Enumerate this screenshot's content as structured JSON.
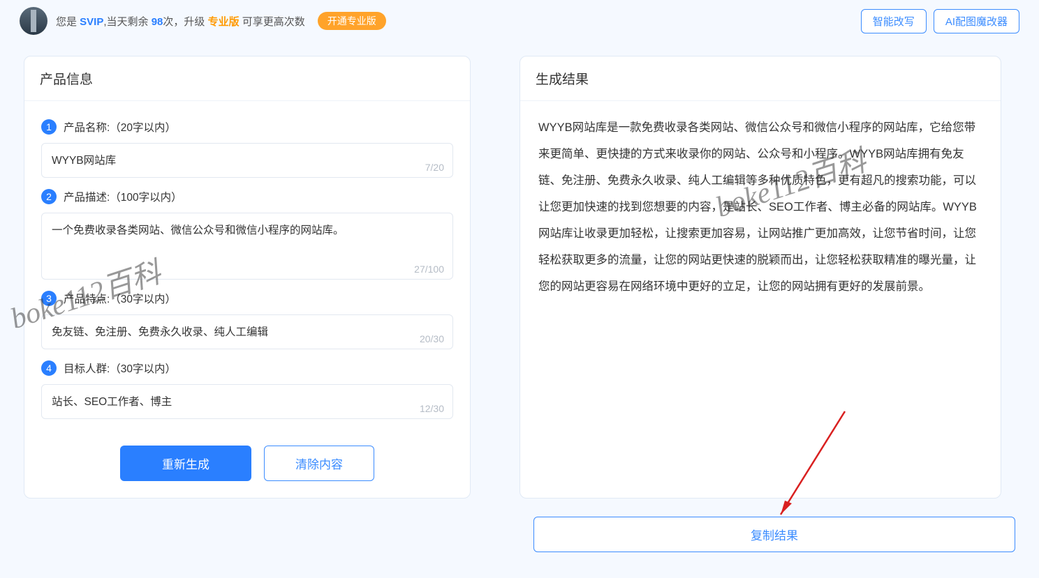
{
  "header": {
    "prefix": "您是 ",
    "svip": "SVIP",
    "mid1": ",当天剩余 ",
    "count": "98",
    "mid2": "次，升级 ",
    "pro": "专业版",
    "mid3": " 可享更高次数",
    "open_pro": "开通专业版",
    "rewrite_btn": "智能改写",
    "ai_image_btn": "AI配图魔改器"
  },
  "left": {
    "title": "产品信息",
    "fields": [
      {
        "num": "1",
        "label": "产品名称:（20字以内）",
        "value": "WYYB网站库",
        "counter": "7/20"
      },
      {
        "num": "2",
        "label": "产品描述:（100字以内）",
        "value": "一个免费收录各类网站、微信公众号和微信小程序的网站库。",
        "counter": "27/100"
      },
      {
        "num": "3",
        "label": "产品特点:（30字以内）",
        "value": "免友链、免注册、免费永久收录、纯人工编辑",
        "counter": "20/30"
      },
      {
        "num": "4",
        "label": "目标人群:（30字以内）",
        "value": "站长、SEO工作者、博主",
        "counter": "12/30"
      }
    ],
    "regen": "重新生成",
    "clear": "清除内容"
  },
  "right": {
    "title": "生成结果",
    "content": "WYYB网站库是一款免费收录各类网站、微信公众号和微信小程序的网站库，它给您带来更简单、更快捷的方式来收录你的网站、公众号和小程序。WYYB网站库拥有免友链、免注册、免费永久收录、纯人工编辑等多种优质特色，更有超凡的搜索功能，可以让您更加快速的找到您想要的内容，是站长、SEO工作者、博主必备的网站库。WYYB网站库让收录更加轻松，让搜索更加容易，让网站推广更加高效，让您节省时间，让您轻松获取更多的流量，让您的网站更快速的脱颖而出，让您轻松获取精准的曝光量，让您的网站更容易在网络环境中更好的立足，让您的网站拥有更好的发展前景。",
    "copy": "复制结果"
  },
  "watermark": "boke112百科"
}
